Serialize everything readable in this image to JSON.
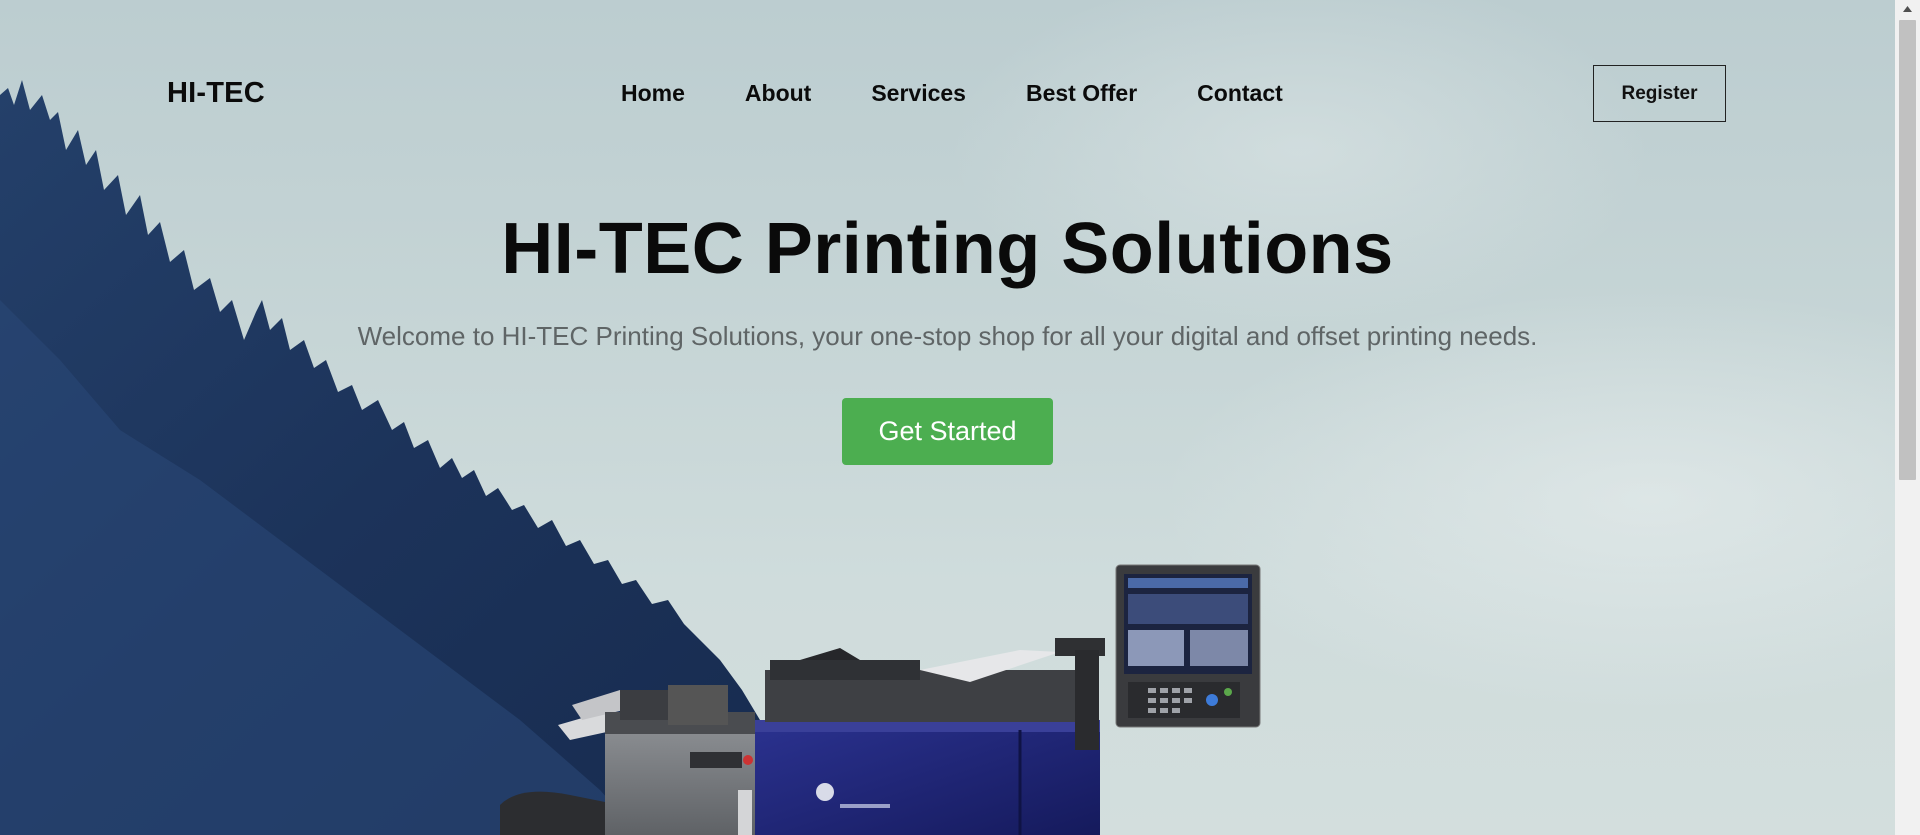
{
  "nav": {
    "brand": "HI-TEC",
    "links": [
      "Home",
      "About",
      "Services",
      "Best Offer",
      "Contact"
    ],
    "register_label": "Register"
  },
  "hero": {
    "title": "HI-TEC Printing Solutions",
    "subtitle": "Welcome to HI-TEC Printing Solutions, your one-stop shop for all your digital and offset printing needs.",
    "cta_label": "Get Started"
  },
  "colors": {
    "cta_background": "#4cae50",
    "forest": "#1b3155",
    "sky": "#c6d5d6"
  },
  "icons": {
    "printer": "printer-image",
    "scroll_up": "chevron-up-icon"
  }
}
